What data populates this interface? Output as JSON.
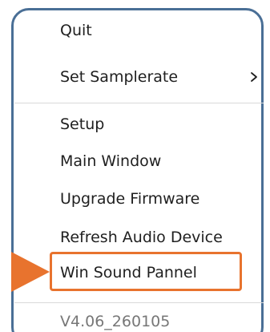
{
  "menu": {
    "items": [
      {
        "label": "Quit"
      },
      {
        "label": "Set Samplerate",
        "has_submenu": true
      },
      {
        "label": "Setup"
      },
      {
        "label": "Main Window"
      },
      {
        "label": "Upgrade Firmware"
      },
      {
        "label": "Refresh Audio Device"
      },
      {
        "label": "Win Sound Pannel",
        "highlighted": true
      },
      {
        "label": "V4.06_260105",
        "disabled": true
      }
    ]
  },
  "colors": {
    "menu_border": "#4a6f96",
    "highlight": "#e8732e",
    "text": "#1f1f1f",
    "disabled_text": "#777777"
  },
  "icons": {
    "submenu": "chevron-right-icon",
    "pointer": "arrow-right-icon"
  }
}
